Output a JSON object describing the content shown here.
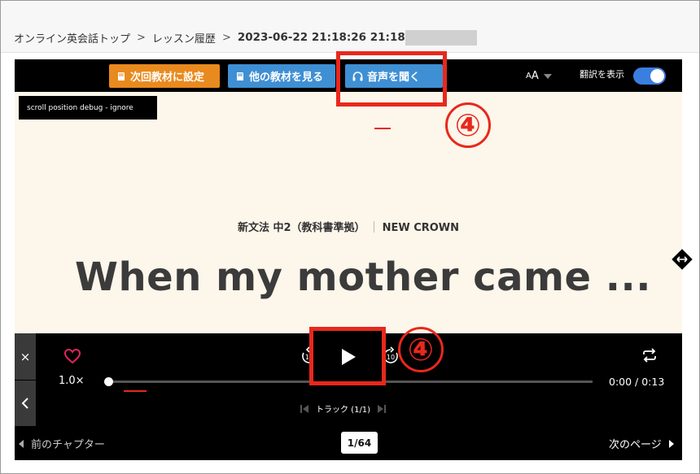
{
  "breadcrumb": {
    "items": [
      "オンライン英会話トップ",
      "レッスン履歴"
    ],
    "current": "2023-06-22 21:18:26 21:18",
    "separator": ">"
  },
  "toolbar": {
    "next_material_label": "次回教材に設定",
    "other_material_label": "他の教材を見る",
    "audio_label": "音声を聞く",
    "font_size_label_small": "A",
    "font_size_label_large": "A",
    "translate_label": "翻訳を表示",
    "translate_on": true
  },
  "content": {
    "debug_label": "scroll position debug - ignore",
    "category": "新文法 中2（教科書準拠）",
    "series": "NEW CROWN",
    "title": "When my mother came ..."
  },
  "player": {
    "close_icon": "×",
    "speed": "1.0×",
    "rewind_seconds": "10",
    "forward_seconds": "10",
    "progress": 0.0,
    "time": "0:00 / 0:13",
    "track_label": "トラック (1/1)"
  },
  "pager": {
    "prev_label": "前のチャプター",
    "page": "1/64",
    "next_label": "次のページ"
  },
  "annotations": {
    "num_1": "④",
    "num_2": "④",
    "color": "#e8281c"
  },
  "colors": {
    "orange": "#e98a1e",
    "blue": "#3f8fd4",
    "content_bg": "#fdf6ea",
    "heart": "#e0245e"
  }
}
